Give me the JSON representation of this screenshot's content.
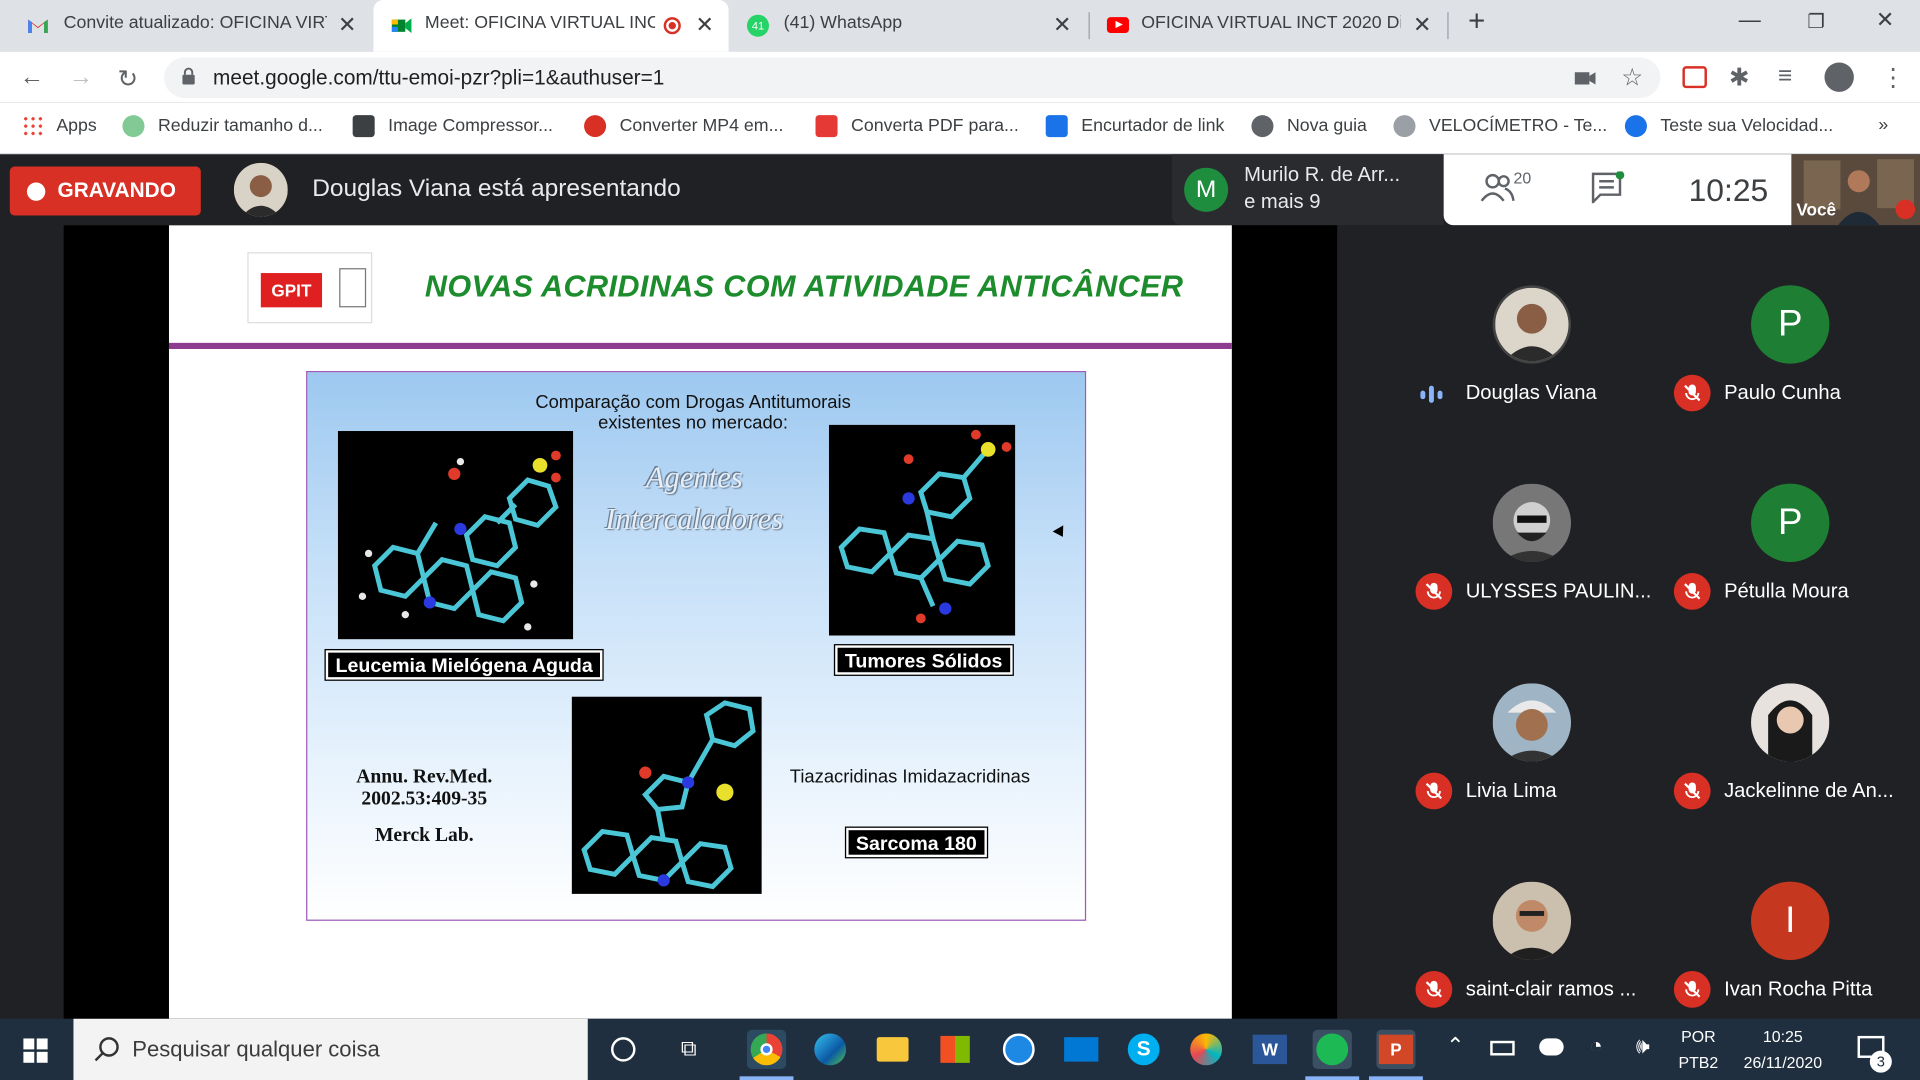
{
  "browser": {
    "tabs": [
      {
        "title": "Convite atualizado: OFICINA VIRT",
        "icon": "gmail-icon"
      },
      {
        "title": "Meet: OFICINA VIRTUAL INC",
        "icon": "meet-icon",
        "active": true
      },
      {
        "title": "(41) WhatsApp",
        "icon": "whatsapp-icon"
      },
      {
        "title": "OFICINA VIRTUAL INCT 2020 Dia",
        "icon": "youtube-icon"
      }
    ],
    "url": "meet.google.com/ttu-emoi-pzr?pli=1&authuser=1",
    "bookmarks": [
      {
        "label": "Apps",
        "color": "#4285f4"
      },
      {
        "label": "Reduzir tamanho d...",
        "color": "#81c995"
      },
      {
        "label": "Image Compressor...",
        "color": "#3c4043"
      },
      {
        "label": "Converter MP4 em...",
        "color": "#d93025"
      },
      {
        "label": "Converta PDF para...",
        "color": "#e53935"
      },
      {
        "label": "Encurtador de link",
        "color": "#1a73e8"
      },
      {
        "label": "Nova guia",
        "color": "#5f6368"
      },
      {
        "label": "VELOCÍMETRO - Te...",
        "color": "#9aa0a6"
      },
      {
        "label": "Teste sua Velocidad...",
        "color": "#1a73e8"
      }
    ],
    "more_bookmarks": "»"
  },
  "meet": {
    "recording_label": "GRAVANDO",
    "presenter_text": "Douglas Viana está apresentando",
    "speaking": {
      "initial": "M",
      "line1": "Murilo R. de Arr...",
      "line2": "e mais 9"
    },
    "people_count": "20",
    "time": "10:25",
    "self_label": "Você"
  },
  "slide": {
    "logo_text": "GPIT",
    "title": "NOVAS ACRIDINAS COM ATIVIDADE ANTICÂNCER",
    "comparison_line1": "Comparação com Drogas Antitumorais",
    "comparison_line2": "existentes no mercado:",
    "agents_line1": "Agentes",
    "agents_line2": "Intercaladores",
    "label_leukemia": "Leucemia Mielógena Aguda",
    "label_tumors": "Tumores Sólidos",
    "ref_line1": "Annu. Rev.Med.",
    "ref_line2": "2002.53:409-35",
    "ref_line3": "Merck Lab.",
    "tiaz_text": "Tiazacridinas Imidazacridinas",
    "label_sarcoma": "Sarcoma 180"
  },
  "participants": [
    {
      "name": "Douglas Viana",
      "initial": "",
      "color": "#8a6a52",
      "muted": false,
      "photo": true
    },
    {
      "name": "Paulo Cunha",
      "initial": "P",
      "color": "#1e7e34",
      "muted": true,
      "photo": false
    },
    {
      "name": "ULYSSES PAULIN...",
      "initial": "",
      "color": "#555555",
      "muted": true,
      "photo": true
    },
    {
      "name": "Pétulla Moura",
      "initial": "P",
      "color": "#1e7e34",
      "muted": true,
      "photo": false
    },
    {
      "name": "Livia Lima",
      "initial": "",
      "color": "#a07a60",
      "muted": true,
      "photo": true
    },
    {
      "name": "Jackelinne de An...",
      "initial": "",
      "color": "#cfc6c0",
      "muted": true,
      "photo": true
    },
    {
      "name": "saint-clair ramos ...",
      "initial": "",
      "color": "#b08870",
      "muted": true,
      "photo": true
    },
    {
      "name": "Ivan Rocha Pitta",
      "initial": "I",
      "color": "#c5381f",
      "muted": true,
      "photo": false
    }
  ],
  "taskbar": {
    "search_placeholder": "Pesquisar qualquer coisa",
    "lang1": "POR",
    "lang2": "PTB2",
    "time": "10:25",
    "date": "26/11/2020",
    "notif_count": "3"
  }
}
